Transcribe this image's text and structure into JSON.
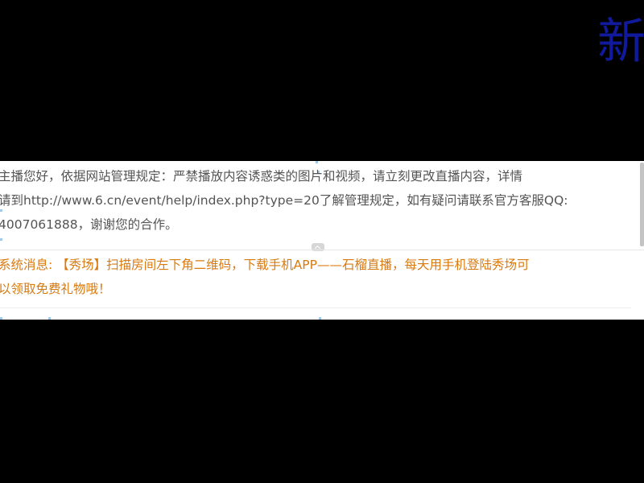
{
  "overlay": {
    "corner_char": "新"
  },
  "chat": {
    "notice_lines": [
      "主播您好，依据网站管理规定：严禁播放内容诱惑类的图片和视频，请立刻更改直播内容，详情",
      "请到http://www.6.cn/event/help/index.php?type=20了解管理规定，如有疑问请联系官方客服QQ:",
      "4007061888，谢谢您的合作。"
    ],
    "system_message_lines": [
      "系统消息: 【秀场】扫描房间左下角二维码，下载手机APP——石榴直播，每天用手机登陆秀场可",
      "以领取免费礼物哦！"
    ]
  },
  "colors": {
    "background": "#000000",
    "panel": "#ffffff",
    "notice_text": "#545454",
    "system_text": "#d9790e",
    "corner_char": "#111a9c",
    "accent_dots": "#9ecbea"
  }
}
